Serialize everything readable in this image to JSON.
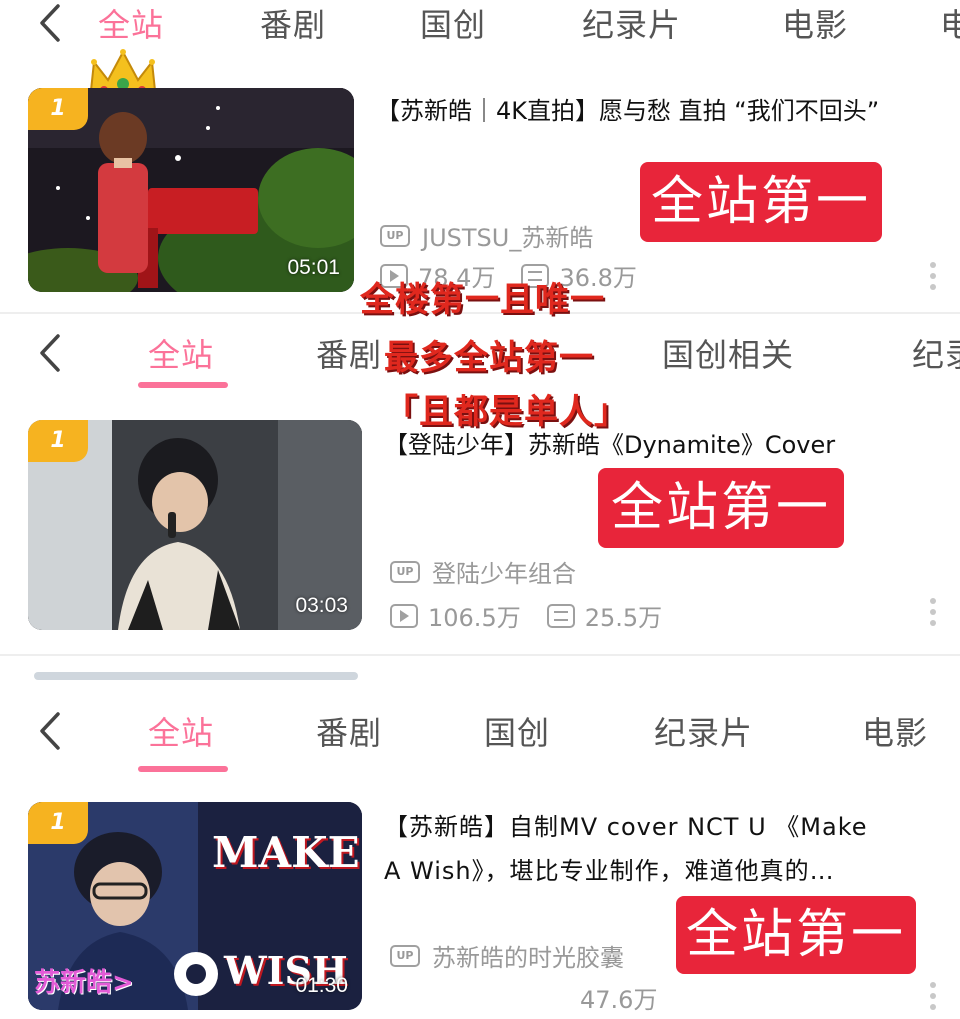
{
  "sections": [
    {
      "tabs": [
        "全站",
        "番剧",
        "国创",
        "纪录片",
        "电影",
        "电"
      ],
      "video": {
        "rank": "1",
        "duration": "05:01",
        "title": "【苏新皓｜4K直拍】愿与愁 直拍 “我们不回头”",
        "uploader": "JUSTSU_苏新皓",
        "views": "78.4万",
        "danmaku": "36.8万"
      },
      "badge": "全站第一"
    },
    {
      "tabs": [
        "全站",
        "番剧",
        "国创相关",
        "纪录"
      ],
      "video": {
        "rank": "1",
        "duration": "03:03",
        "title": "【登陆少年】苏新皓《Dynamite》Cover",
        "uploader": "登陆少年组合",
        "views": "106.5万",
        "danmaku": "25.5万"
      },
      "badge": "全站第一"
    },
    {
      "tabs": [
        "全站",
        "番剧",
        "国创",
        "纪录片",
        "电影"
      ],
      "video": {
        "rank": "1",
        "duration": "01:30",
        "title_line1": "【苏新皓】自制MV cover NCT U 《Make",
        "title_line2": "A Wish》，堪比专业制作，难道他真的…",
        "uploader": "苏新皓的时光胶囊",
        "danmaku": "47.6万",
        "thumb_text_make": "MAKE",
        "thumb_text_wish": "WISH",
        "thumb_tag": "苏新皓>"
      },
      "badge": "全站第一"
    }
  ],
  "overlay": {
    "line1": "全楼第一且唯一",
    "line2": "最多全站第一",
    "line3": "「且都是单人」"
  },
  "labels": {
    "up": "UP"
  },
  "colors": {
    "accent": "#fb7299",
    "badge_red": "#e8253a",
    "rank_gold": "#f6b320"
  }
}
